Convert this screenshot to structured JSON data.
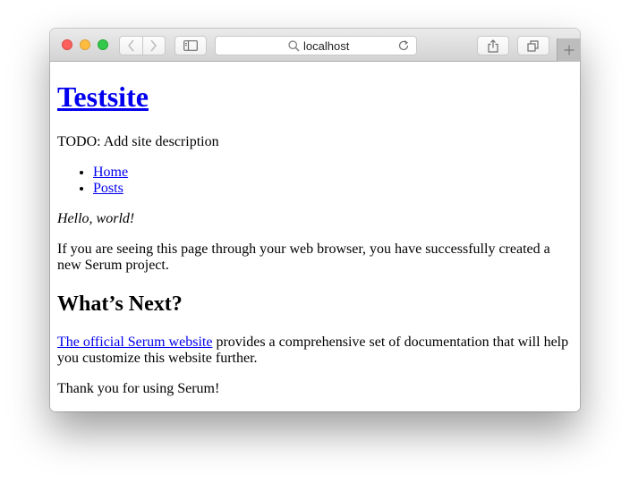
{
  "browser": {
    "address_text": "localhost",
    "icons": {
      "back": "chevron-left-icon",
      "forward": "chevron-right-icon",
      "sidebar": "sidebar-icon",
      "search": "search-icon",
      "reload": "reload-icon",
      "share": "share-icon",
      "tabs": "tabs-overview-icon",
      "new_tab": "plus-icon"
    },
    "colors": {
      "close": "#fc605c",
      "minimize": "#fdbc40",
      "zoom": "#34c84a",
      "link": "#0000ee"
    }
  },
  "page": {
    "site_title": "Testsite",
    "site_description": "TODO: Add site description",
    "nav_items": [
      {
        "label": "Home"
      },
      {
        "label": "Posts"
      }
    ],
    "greeting": "Hello, world!",
    "intro_paragraph": "If you are seeing this page through your web browser, you have successfully created a new Serum project.",
    "section_heading": "What’s Next?",
    "next_link": "The official Serum website",
    "next_paragraph_rest": " provides a comprehensive set of documentation that will help you customize this website further.",
    "thanks": "Thank you for using Serum!"
  }
}
